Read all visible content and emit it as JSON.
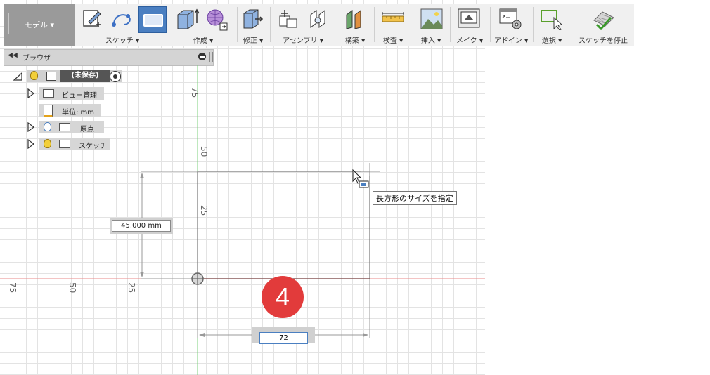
{
  "workspace": {
    "label": "モデル ▾"
  },
  "toolbar": {
    "groups": [
      {
        "label": "スケッチ ▾"
      },
      {
        "label": "作成 ▾"
      },
      {
        "label": "修正 ▾"
      },
      {
        "label": "アセンブリ ▾"
      },
      {
        "label": "構築 ▾"
      },
      {
        "label": "検査 ▾"
      },
      {
        "label": "挿入 ▾"
      },
      {
        "label": "メイク ▾"
      },
      {
        "label": "アドイン ▾"
      },
      {
        "label": "選択 ▾"
      },
      {
        "label": "スケッチを停止"
      }
    ]
  },
  "browser": {
    "title": "ブラウザ",
    "root": "(未保存)",
    "items": [
      {
        "label": "ビュー管理"
      },
      {
        "label": "単位: mm"
      },
      {
        "label": "原点"
      },
      {
        "label": "スケッチ"
      }
    ]
  },
  "canvas": {
    "vertical_axis_labels": [
      "75",
      "50",
      "25"
    ],
    "horizontal_axis_labels": [
      "75",
      "50",
      "25"
    ],
    "height_dimension": "45.000 mm",
    "width_input_value": "72",
    "tooltip": "長方形のサイズを指定",
    "step_badge": "4"
  },
  "colors": {
    "x_axis": "#e88a8a",
    "y_axis": "#7cd07c",
    "accent": "#4a7fc1",
    "badge": "#e23b3b"
  }
}
